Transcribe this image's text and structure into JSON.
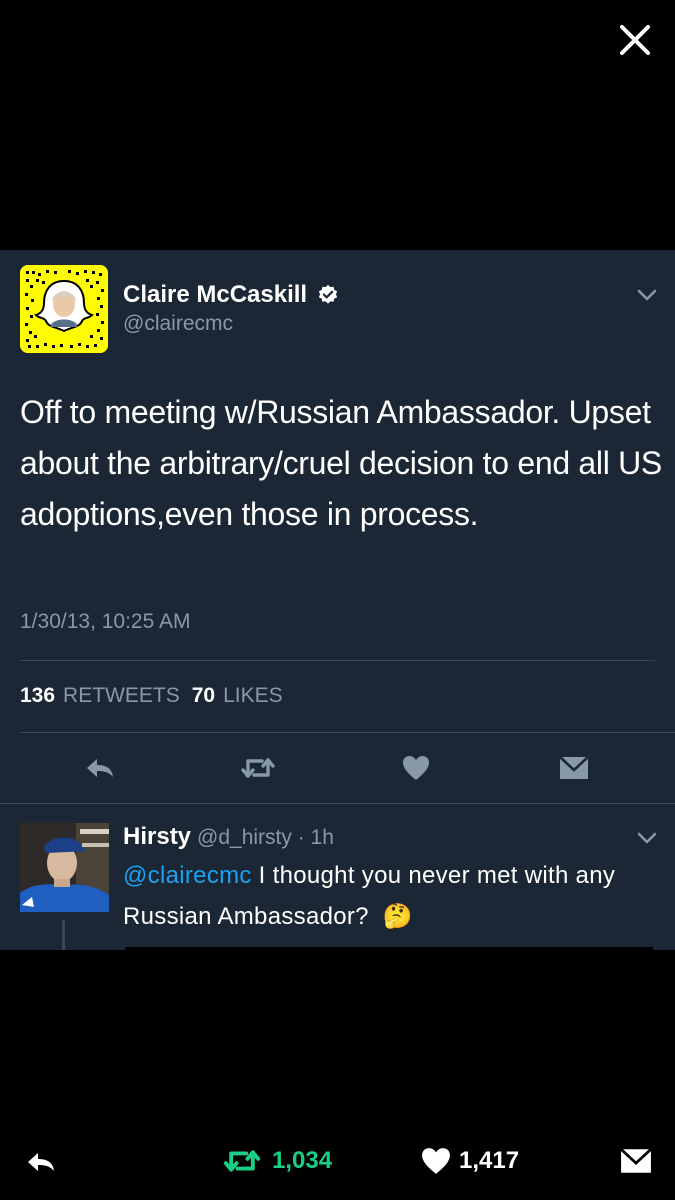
{
  "tweet": {
    "author_name": "Claire McCaskill",
    "author_handle": "@clairecmc",
    "text": "Off to meeting w/Russian Ambassador. Upset about the arbitrary/cruel decision to end all US adoptions,even those in process.",
    "timestamp": "1/30/13, 10:25 AM",
    "retweet_count": "136",
    "retweet_label": "RETWEETS",
    "like_count": "70",
    "like_label": "LIKES"
  },
  "reply": {
    "author_name": "Hirsty",
    "author_handle": "@d_hirsty · 1h",
    "mention": "@clairecmc",
    "text": " I thought you never met with any Russian Ambassador?",
    "emoji": "🤔"
  },
  "bottom_bar": {
    "retweet_count": "1,034",
    "like_count": "1,417"
  },
  "icons": {
    "close": "close-icon",
    "verified": "verified-badge-icon",
    "reply": "reply-icon",
    "retweet": "retweet-icon",
    "like": "heart-icon",
    "dm": "envelope-icon"
  },
  "colors": {
    "card_bg": "#1b2734",
    "muted": "#8899a6",
    "accent": "#1da1f2",
    "retweet_active": "#19cf86",
    "snapcode_yellow": "#fffc00"
  }
}
